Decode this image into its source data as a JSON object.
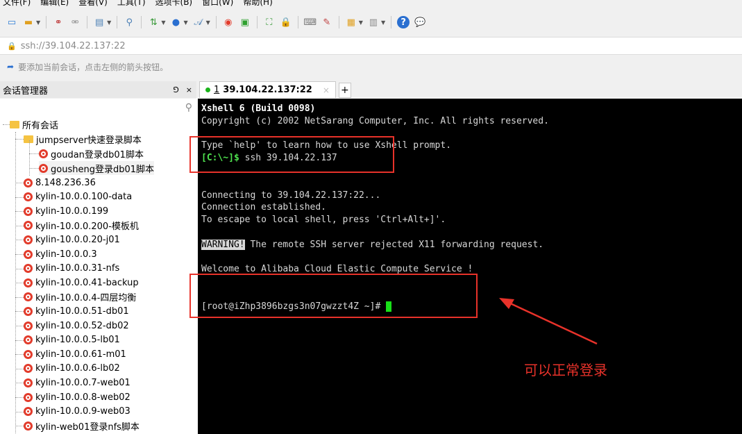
{
  "menu": {
    "items": [
      "文件(F)",
      "编辑(E)",
      "查看(V)",
      "工具(T)",
      "选项卡(B)",
      "窗口(W)",
      "帮助(H)"
    ]
  },
  "address": {
    "value": "ssh://39.104.22.137:22"
  },
  "hint": {
    "text": "要添加当前会话，点击左侧的箭头按钮。"
  },
  "session_panel": {
    "title": "会话管理器",
    "pin": "⅁",
    "close": "×",
    "root": "所有会话",
    "folder": "jumpserver快速登录脚本",
    "folder_children": [
      "goudan登录db01脚本",
      "gousheng登录db01脚本"
    ],
    "sessions": [
      "8.148.236.36",
      "kylin-10.0.0.100-data",
      "kylin-10.0.0.199",
      "kylin-10.0.0.200-模板机",
      "kylin-10.0.0.20-j01",
      "kylin-10.0.0.3",
      "kylin-10.0.0.31-nfs",
      "kylin-10.0.0.41-backup",
      "kylin-10.0.0.4-四层均衡",
      "kylin-10.0.0.51-db01",
      "kylin-10.0.0.52-db02",
      "kylin-10.0.0.5-lb01",
      "kylin-10.0.0.61-m01",
      "kylin-10.0.0.6-lb02",
      "kylin-10.0.0.7-web01",
      "kylin-10.0.0.8-web02",
      "kylin-10.0.0.9-web03",
      "kylin-web01登录nfs脚本"
    ]
  },
  "tab": {
    "number": "1",
    "label": "39.104.22.137:22",
    "close": "×",
    "add": "+"
  },
  "terminal": {
    "line1": "Xshell 6 (Build 0098)",
    "line2": "Copyright (c) 2002 NetSarang Computer, Inc. All rights reserved.",
    "line3": "Type `help' to learn how to use Xshell prompt.",
    "prompt_local": "[C:\\~]$",
    "cmd": " ssh 39.104.22.137",
    "conn1": "Connecting to 39.104.22.137:22...",
    "conn2": "Connection established.",
    "conn3": "To escape to local shell, press 'Ctrl+Alt+]'.",
    "warn_tag": "WARNING!",
    "warn_text": " The remote SSH server rejected X11 forwarding request.",
    "welcome": "Welcome to Alibaba Cloud Elastic Compute Service !",
    "remote_prompt": "[root@iZhp3896bzgs3n07gwzzt4Z ~]# "
  },
  "annotation": {
    "text": "可以正常登录",
    "color": "#e8322a"
  }
}
